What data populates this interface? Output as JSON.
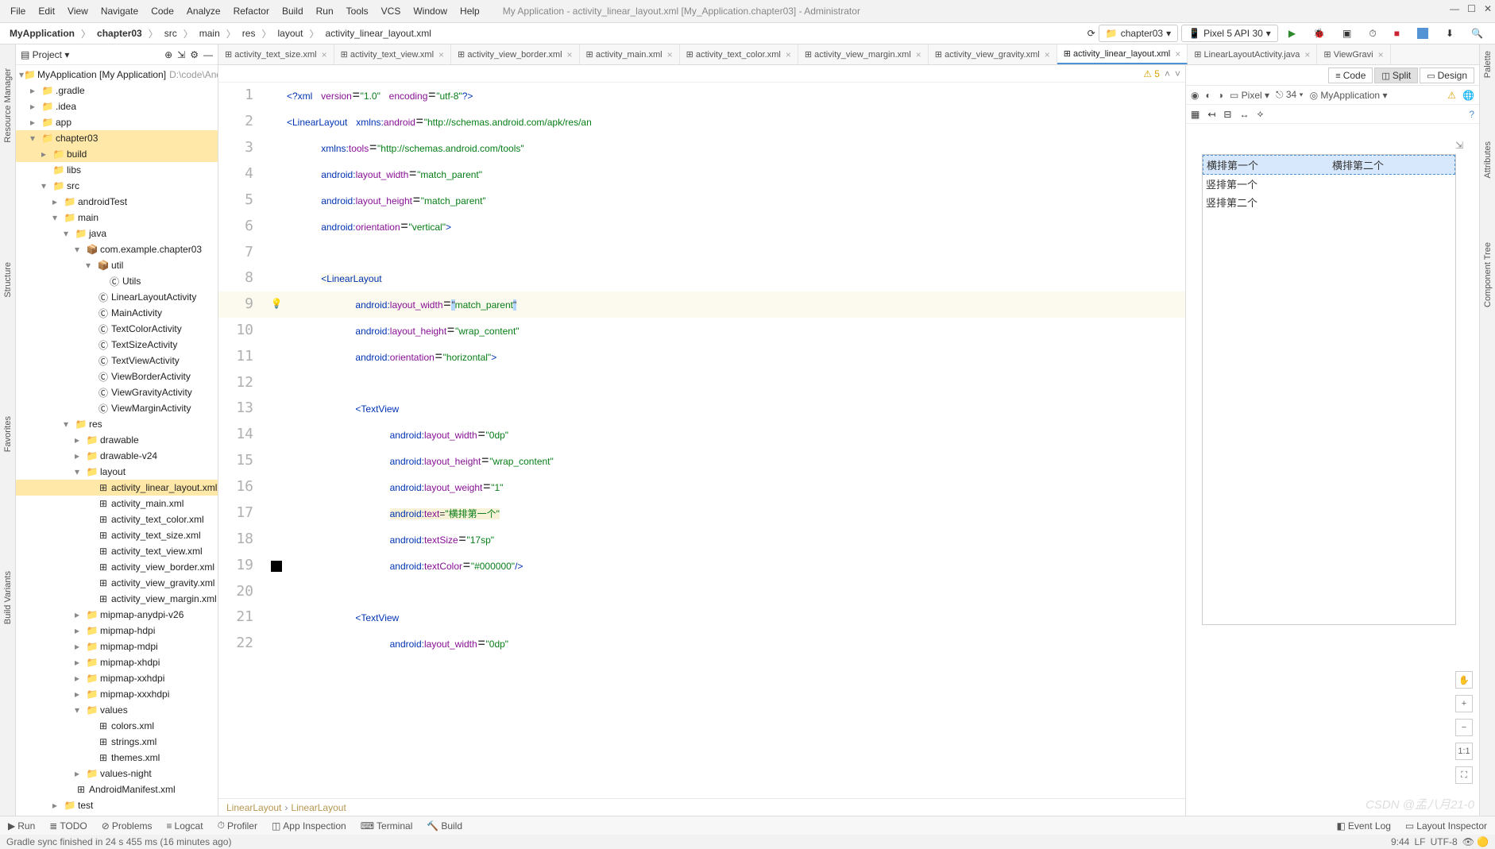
{
  "window": {
    "title": "My Application - activity_linear_layout.xml [My_Application.chapter03] - Administrator"
  },
  "menu": [
    "File",
    "Edit",
    "View",
    "Navigate",
    "Code",
    "Analyze",
    "Refactor",
    "Build",
    "Run",
    "Tools",
    "VCS",
    "Window",
    "Help"
  ],
  "breadcrumbs": [
    "MyApplication",
    "chapter03",
    "src",
    "main",
    "res",
    "layout",
    "activity_linear_layout.xml"
  ],
  "toolbar": {
    "module": "chapter03",
    "device": "Pixel 5 API 30",
    "view_modes": {
      "code": "Code",
      "split": "Split",
      "design": "Design"
    }
  },
  "project_panel": {
    "title": "Project"
  },
  "left_docks": [
    "Resource Manager",
    "Structure",
    "Favorites",
    "Build Variants"
  ],
  "right_docks": [
    "Palette",
    "Attributes",
    "Component Tree"
  ],
  "tree": [
    {
      "depth": 0,
      "arrow": "▾",
      "icon": "📁",
      "text": "MyApplication [My Application]",
      "hint": "D:\\code\\Andr"
    },
    {
      "depth": 1,
      "arrow": "▸",
      "icon": "📁",
      "text": ".gradle"
    },
    {
      "depth": 1,
      "arrow": "▸",
      "icon": "📁",
      "text": ".idea"
    },
    {
      "depth": 1,
      "arrow": "▸",
      "icon": "📁",
      "text": "app"
    },
    {
      "depth": 1,
      "arrow": "▾",
      "icon": "📁",
      "text": "chapter03",
      "sel": true
    },
    {
      "depth": 2,
      "arrow": "▸",
      "icon": "📁",
      "text": "build",
      "sel": true
    },
    {
      "depth": 2,
      "arrow": "",
      "icon": "📁",
      "text": "libs"
    },
    {
      "depth": 2,
      "arrow": "▾",
      "icon": "📁",
      "text": "src"
    },
    {
      "depth": 3,
      "arrow": "▸",
      "icon": "📁",
      "text": "androidTest"
    },
    {
      "depth": 3,
      "arrow": "▾",
      "icon": "📁",
      "text": "main"
    },
    {
      "depth": 4,
      "arrow": "▾",
      "icon": "📁",
      "text": "java"
    },
    {
      "depth": 5,
      "arrow": "▾",
      "icon": "📦",
      "text": "com.example.chapter03"
    },
    {
      "depth": 6,
      "arrow": "▾",
      "icon": "📦",
      "text": "util"
    },
    {
      "depth": 7,
      "arrow": "",
      "icon": "Ⓒ",
      "text": "Utils"
    },
    {
      "depth": 6,
      "arrow": "",
      "icon": "Ⓒ",
      "text": "LinearLayoutActivity"
    },
    {
      "depth": 6,
      "arrow": "",
      "icon": "Ⓒ",
      "text": "MainActivity"
    },
    {
      "depth": 6,
      "arrow": "",
      "icon": "Ⓒ",
      "text": "TextColorActivity"
    },
    {
      "depth": 6,
      "arrow": "",
      "icon": "Ⓒ",
      "text": "TextSizeActivity"
    },
    {
      "depth": 6,
      "arrow": "",
      "icon": "Ⓒ",
      "text": "TextViewActivity"
    },
    {
      "depth": 6,
      "arrow": "",
      "icon": "Ⓒ",
      "text": "ViewBorderActivity"
    },
    {
      "depth": 6,
      "arrow": "",
      "icon": "Ⓒ",
      "text": "ViewGravityActivity"
    },
    {
      "depth": 6,
      "arrow": "",
      "icon": "Ⓒ",
      "text": "ViewMarginActivity"
    },
    {
      "depth": 4,
      "arrow": "▾",
      "icon": "📁",
      "text": "res"
    },
    {
      "depth": 5,
      "arrow": "▸",
      "icon": "📁",
      "text": "drawable"
    },
    {
      "depth": 5,
      "arrow": "▸",
      "icon": "📁",
      "text": "drawable-v24"
    },
    {
      "depth": 5,
      "arrow": "▾",
      "icon": "📁",
      "text": "layout"
    },
    {
      "depth": 6,
      "arrow": "",
      "icon": "⊞",
      "text": "activity_linear_layout.xml",
      "sel": true
    },
    {
      "depth": 6,
      "arrow": "",
      "icon": "⊞",
      "text": "activity_main.xml"
    },
    {
      "depth": 6,
      "arrow": "",
      "icon": "⊞",
      "text": "activity_text_color.xml"
    },
    {
      "depth": 6,
      "arrow": "",
      "icon": "⊞",
      "text": "activity_text_size.xml"
    },
    {
      "depth": 6,
      "arrow": "",
      "icon": "⊞",
      "text": "activity_text_view.xml"
    },
    {
      "depth": 6,
      "arrow": "",
      "icon": "⊞",
      "text": "activity_view_border.xml"
    },
    {
      "depth": 6,
      "arrow": "",
      "icon": "⊞",
      "text": "activity_view_gravity.xml"
    },
    {
      "depth": 6,
      "arrow": "",
      "icon": "⊞",
      "text": "activity_view_margin.xml"
    },
    {
      "depth": 5,
      "arrow": "▸",
      "icon": "📁",
      "text": "mipmap-anydpi-v26"
    },
    {
      "depth": 5,
      "arrow": "▸",
      "icon": "📁",
      "text": "mipmap-hdpi"
    },
    {
      "depth": 5,
      "arrow": "▸",
      "icon": "📁",
      "text": "mipmap-mdpi"
    },
    {
      "depth": 5,
      "arrow": "▸",
      "icon": "📁",
      "text": "mipmap-xhdpi"
    },
    {
      "depth": 5,
      "arrow": "▸",
      "icon": "📁",
      "text": "mipmap-xxhdpi"
    },
    {
      "depth": 5,
      "arrow": "▸",
      "icon": "📁",
      "text": "mipmap-xxxhdpi"
    },
    {
      "depth": 5,
      "arrow": "▾",
      "icon": "📁",
      "text": "values"
    },
    {
      "depth": 6,
      "arrow": "",
      "icon": "⊞",
      "text": "colors.xml"
    },
    {
      "depth": 6,
      "arrow": "",
      "icon": "⊞",
      "text": "strings.xml"
    },
    {
      "depth": 6,
      "arrow": "",
      "icon": "⊞",
      "text": "themes.xml"
    },
    {
      "depth": 5,
      "arrow": "▸",
      "icon": "📁",
      "text": "values-night"
    },
    {
      "depth": 4,
      "arrow": "",
      "icon": "⊞",
      "text": "AndroidManifest.xml"
    },
    {
      "depth": 3,
      "arrow": "▸",
      "icon": "📁",
      "text": "test"
    }
  ],
  "tabs": [
    {
      "label": "activity_text_size.xml"
    },
    {
      "label": "activity_text_view.xml"
    },
    {
      "label": "activity_view_border.xml"
    },
    {
      "label": "activity_main.xml"
    },
    {
      "label": "activity_text_color.xml"
    },
    {
      "label": "activity_view_margin.xml"
    },
    {
      "label": "activity_view_gravity.xml"
    },
    {
      "label": "activity_linear_layout.xml",
      "active": true
    },
    {
      "label": "LinearLayoutActivity.java"
    },
    {
      "label": "ViewGravi"
    }
  ],
  "code_warn": {
    "count": "5"
  },
  "code_lines": [
    {
      "n": 1,
      "html": "<span class='tag'>&lt;?xml</span> <span class='attr'>version</span>=<span class='str'>\"1.0\"</span> <span class='attr'>encoding</span>=<span class='str'>\"utf-8\"</span><span class='tag'>?&gt;</span>"
    },
    {
      "n": 2,
      "html": "<span class='tag'>&lt;LinearLayout</span> <span class='ns'>xmlns:</span><span class='attr'>android</span>=<span class='str'>\"http://schemas.android.com/apk/res/an</span>"
    },
    {
      "n": 3,
      "html": "    <span class='ns'>xmlns:</span><span class='attr'>tools</span>=<span class='str'>\"http://schemas.android.com/tools\"</span>"
    },
    {
      "n": 4,
      "html": "    <span class='ns'>android:</span><span class='attr'>layout_width</span>=<span class='str'>\"match_parent\"</span>"
    },
    {
      "n": 5,
      "html": "    <span class='ns'>android:</span><span class='attr'>layout_height</span>=<span class='str'>\"match_parent\"</span>"
    },
    {
      "n": 6,
      "html": "    <span class='ns'>android:</span><span class='attr'>orientation</span>=<span class='str'>\"vertical\"</span><span class='tag'>&gt;</span>"
    },
    {
      "n": 7,
      "html": ""
    },
    {
      "n": 8,
      "html": "    <span class='tag hl-row'>&lt;LinearLayout</span>",
      "rowcls": ""
    },
    {
      "n": 9,
      "html": "        <span class='ns'>android:</span><span class='attr'>layout_width</span>=<span class='caret-mark'>\"</span><span class='str'>match_parent</span><span class='caret-mark'>\"</span>",
      "rowcls": "hl-row",
      "lamp": true
    },
    {
      "n": 10,
      "html": "        <span class='ns'>android:</span><span class='attr'>layout_height</span>=<span class='str'>\"wrap_content\"</span>"
    },
    {
      "n": 11,
      "html": "        <span class='ns'>android:</span><span class='attr'>orientation</span>=<span class='str'>\"horizontal\"</span><span class='tag'>&gt;</span>"
    },
    {
      "n": 12,
      "html": ""
    },
    {
      "n": 13,
      "html": "        <span class='tag'>&lt;TextView</span>"
    },
    {
      "n": 14,
      "html": "            <span class='ns'>android:</span><span class='attr'>layout_width</span>=<span class='str'>\"0dp\"</span>"
    },
    {
      "n": 15,
      "html": "            <span class='ns'>android:</span><span class='attr'>layout_height</span>=<span class='str'>\"wrap_content\"</span>"
    },
    {
      "n": 16,
      "html": "            <span class='ns'>android:</span><span class='attr'>layout_weight</span>=<span class='str'>\"1\"</span>"
    },
    {
      "n": 17,
      "html": "            <span class='ns hl-warn'>android:</span><span class='attr hl-warn'>text</span><span class='hl-warn'>=</span><span class='str hl-warn'>\"横排第一个\"</span>"
    },
    {
      "n": 18,
      "html": "            <span class='ns'>android:</span><span class='attr'>textSize</span>=<span class='str'>\"17sp\"</span>"
    },
    {
      "n": 19,
      "html": "            <span class='ns'>android:</span><span class='attr'>textColor</span>=<span class='str'>\"#000000\"</span><span class='tag'>/&gt;</span>",
      "swatch": true
    },
    {
      "n": 20,
      "html": ""
    },
    {
      "n": 21,
      "html": "        <span class='tag'>&lt;TextView</span>"
    },
    {
      "n": 22,
      "html": "            <span class='ns'>android:</span><span class='attr'>layout_width</span>=<span class='str'>\"0dp\"</span>"
    }
  ],
  "breadcrumb_code": [
    "LinearLayout",
    "LinearLayout"
  ],
  "preview": {
    "hz1": "横排第一个",
    "hz2": "横排第二个",
    "vt1": "竖排第一个",
    "vt2": "竖排第二个"
  },
  "design_bar": {
    "pixel": "Pixel",
    "api": "34",
    "app": "MyApplication"
  },
  "bottom": {
    "run": "Run",
    "todo": "TODO",
    "problems": "Problems",
    "logcat": "Logcat",
    "profiler": "Profiler",
    "appinsp": "App Inspection",
    "terminal": "Terminal",
    "build": "Build",
    "eventlog": "Event Log",
    "layoutinsp": "Layout Inspector"
  },
  "status": {
    "msg": "Gradle sync finished in 24 s 455 ms (16 minutes ago)",
    "time": "9:44",
    "lf": "LF",
    "enc": "UTF-8"
  },
  "zoom": {
    "plus": "+",
    "minus": "−",
    "fit": "1:1",
    "full": "⛶"
  }
}
